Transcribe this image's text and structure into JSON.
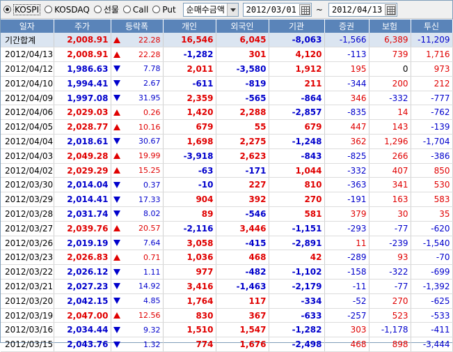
{
  "toolbar": {
    "markets": [
      {
        "label": "KOSPI",
        "checked": true
      },
      {
        "label": "KOSDAQ",
        "checked": false
      },
      {
        "label": "선물",
        "checked": false
      },
      {
        "label": "Call",
        "checked": false
      },
      {
        "label": "Put",
        "checked": false
      }
    ],
    "mode_select": "순매수금액",
    "date_from": "2012/03/01",
    "separator": "~",
    "date_to": "2012/04/13"
  },
  "table": {
    "headers": [
      "일자",
      "주가",
      "등락폭",
      "개인",
      "외국인",
      "기관",
      "증권",
      "보험",
      "투신"
    ],
    "summary": {
      "date": "기간합계",
      "price": "2,008.91",
      "dir": "up",
      "change": "22.28",
      "individual": "16,546",
      "foreign": "6,045",
      "institution": "-8,063",
      "securities": "-1,566",
      "insurance": "6,389",
      "trust": "-11,209"
    },
    "rows": [
      {
        "date": "2012/04/13",
        "price": "2,008.91",
        "dir": "up",
        "change": "22.28",
        "individual": "-1,282",
        "foreign": "301",
        "institution": "4,120",
        "securities": "-113",
        "insurance": "739",
        "trust": "1,716"
      },
      {
        "date": "2012/04/12",
        "price": "1,986.63",
        "dir": "down",
        "change": "7.78",
        "individual": "2,011",
        "foreign": "-3,580",
        "institution": "1,912",
        "securities": "195",
        "insurance": "0",
        "trust": "973"
      },
      {
        "date": "2012/04/10",
        "price": "1,994.41",
        "dir": "down",
        "change": "2.67",
        "individual": "-611",
        "foreign": "-819",
        "institution": "211",
        "securities": "-344",
        "insurance": "200",
        "trust": "212"
      },
      {
        "date": "2012/04/09",
        "price": "1,997.08",
        "dir": "down",
        "change": "31.95",
        "individual": "2,359",
        "foreign": "-565",
        "institution": "-864",
        "securities": "346",
        "insurance": "-332",
        "trust": "-777"
      },
      {
        "date": "2012/04/06",
        "price": "2,029.03",
        "dir": "up",
        "change": "0.26",
        "individual": "1,420",
        "foreign": "2,288",
        "institution": "-2,857",
        "securities": "-835",
        "insurance": "14",
        "trust": "-762"
      },
      {
        "date": "2012/04/05",
        "price": "2,028.77",
        "dir": "up",
        "change": "10.16",
        "individual": "679",
        "foreign": "55",
        "institution": "679",
        "securities": "447",
        "insurance": "143",
        "trust": "-139"
      },
      {
        "date": "2012/04/04",
        "price": "2,018.61",
        "dir": "down",
        "change": "30.67",
        "individual": "1,698",
        "foreign": "2,275",
        "institution": "-1,248",
        "securities": "362",
        "insurance": "1,296",
        "trust": "-1,704"
      },
      {
        "date": "2012/04/03",
        "price": "2,049.28",
        "dir": "up",
        "change": "19.99",
        "individual": "-3,918",
        "foreign": "2,623",
        "institution": "-843",
        "securities": "-825",
        "insurance": "266",
        "trust": "-386"
      },
      {
        "date": "2012/04/02",
        "price": "2,029.29",
        "dir": "up",
        "change": "15.25",
        "individual": "-63",
        "foreign": "-171",
        "institution": "1,044",
        "securities": "-332",
        "insurance": "407",
        "trust": "850"
      },
      {
        "date": "2012/03/30",
        "price": "2,014.04",
        "dir": "down",
        "change": "0.37",
        "individual": "-10",
        "foreign": "227",
        "institution": "810",
        "securities": "-363",
        "insurance": "341",
        "trust": "530"
      },
      {
        "date": "2012/03/29",
        "price": "2,014.41",
        "dir": "down",
        "change": "17.33",
        "individual": "904",
        "foreign": "392",
        "institution": "270",
        "securities": "-191",
        "insurance": "163",
        "trust": "583"
      },
      {
        "date": "2012/03/28",
        "price": "2,031.74",
        "dir": "down",
        "change": "8.02",
        "individual": "89",
        "foreign": "-546",
        "institution": "581",
        "securities": "379",
        "insurance": "30",
        "trust": "35"
      },
      {
        "date": "2012/03/27",
        "price": "2,039.76",
        "dir": "up",
        "change": "20.57",
        "individual": "-2,116",
        "foreign": "3,446",
        "institution": "-1,151",
        "securities": "-293",
        "insurance": "-77",
        "trust": "-620"
      },
      {
        "date": "2012/03/26",
        "price": "2,019.19",
        "dir": "down",
        "change": "7.64",
        "individual": "3,058",
        "foreign": "-415",
        "institution": "-2,891",
        "securities": "11",
        "insurance": "-239",
        "trust": "-1,540"
      },
      {
        "date": "2012/03/23",
        "price": "2,026.83",
        "dir": "up",
        "change": "0.71",
        "individual": "1,036",
        "foreign": "468",
        "institution": "42",
        "securities": "-289",
        "insurance": "93",
        "trust": "-70"
      },
      {
        "date": "2012/03/22",
        "price": "2,026.12",
        "dir": "down",
        "change": "1.11",
        "individual": "977",
        "foreign": "-482",
        "institution": "-1,102",
        "securities": "-158",
        "insurance": "-322",
        "trust": "-699"
      },
      {
        "date": "2012/03/21",
        "price": "2,027.23",
        "dir": "down",
        "change": "14.92",
        "individual": "3,416",
        "foreign": "-1,463",
        "institution": "-2,179",
        "securities": "-11",
        "insurance": "-77",
        "trust": "-1,392"
      },
      {
        "date": "2012/03/20",
        "price": "2,042.15",
        "dir": "down",
        "change": "4.85",
        "individual": "1,764",
        "foreign": "117",
        "institution": "-334",
        "securities": "-52",
        "insurance": "270",
        "trust": "-625"
      },
      {
        "date": "2012/03/19",
        "price": "2,047.00",
        "dir": "up",
        "change": "12.56",
        "individual": "830",
        "foreign": "367",
        "institution": "-633",
        "securities": "-257",
        "insurance": "523",
        "trust": "-533"
      },
      {
        "date": "2012/03/16",
        "price": "2,034.44",
        "dir": "down",
        "change": "9.32",
        "individual": "1,510",
        "foreign": "1,547",
        "institution": "-1,282",
        "securities": "303",
        "insurance": "-1,178",
        "trust": "-411"
      },
      {
        "date": "2012/03/15",
        "price": "2,043.76",
        "dir": "down",
        "change": "1.32",
        "individual": "774",
        "foreign": "1,676",
        "institution": "-2,498",
        "securities": "468",
        "insurance": "898",
        "trust": "-3,444"
      }
    ]
  },
  "colors": {
    "up": "#e00000",
    "down": "#0000cc",
    "header_bg": "#5a84b9",
    "summary_bg": "#dbe5f1"
  }
}
